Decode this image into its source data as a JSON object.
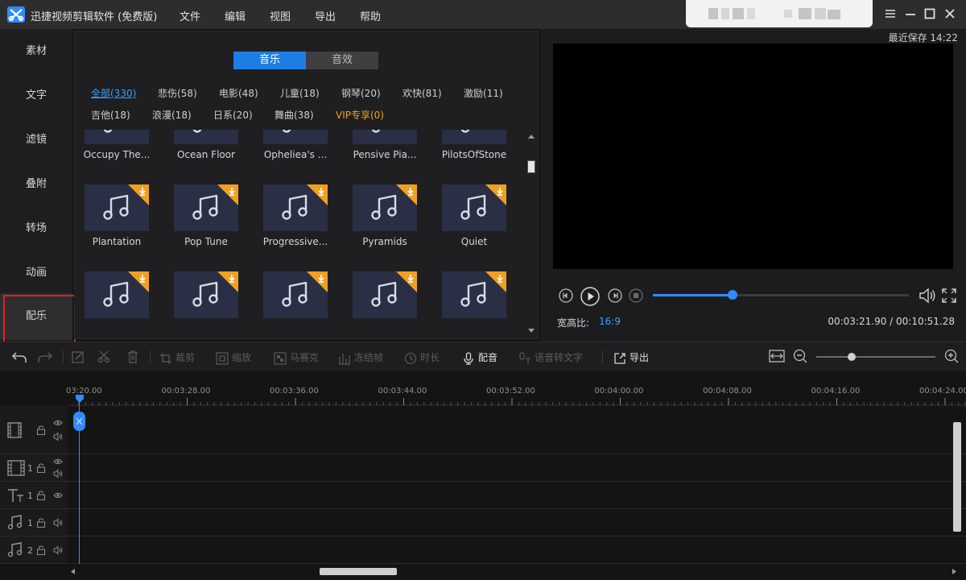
{
  "app": {
    "title": "迅捷视频剪辑软件 (免费版)",
    "menu": [
      "文件",
      "编辑",
      "视图",
      "导出",
      "帮助"
    ]
  },
  "left_tabs": [
    "素材",
    "文字",
    "滤镜",
    "叠附",
    "转场",
    "动画",
    "配乐"
  ],
  "left_tabs_active": "配乐",
  "library": {
    "segments": [
      "音乐",
      "音效"
    ],
    "active_segment": "音乐",
    "categories_row1": [
      "全部(330)",
      "悲伤(58)",
      "电影(48)",
      "儿童(18)",
      "钢琴(20)",
      "欢快(81)",
      "激励(11)"
    ],
    "categories_row2": [
      "吉他(18)",
      "浪漫(18)",
      "日系(20)",
      "舞曲(38)",
      "VIP专享(0)"
    ],
    "active_category": "全部(330)",
    "rows": [
      [
        "Occupy The...",
        "Ocean Floor",
        "Opheliea's ...",
        "Pensive Pia...",
        "PilotsOfStone"
      ],
      [
        "Plantation",
        "Pop Tune",
        "Progressive...",
        "Pyramids",
        "Quiet"
      ],
      [
        "",
        "",
        "",
        "",
        ""
      ]
    ]
  },
  "preview": {
    "last_save": "最近保存 14:22",
    "aspect_label": "宽高比:",
    "aspect_value": "16:9",
    "timecode": "00:03:21.90 / 00:10:51.28",
    "progress": 0.31
  },
  "toolbar": {
    "items": [
      "裁剪",
      "缩放",
      "马赛克",
      "冻结帧",
      "时长",
      "配音",
      "语音转文字",
      "导出"
    ],
    "zoom_level": 0.3
  },
  "timeline": {
    "ticks": [
      "03:20.00",
      "00:03:28.00",
      "00:03:36.00",
      "00:03:44.00",
      "00:03:52.00",
      "00:04:00.00",
      "00:04:08.00",
      "00:04:16.00",
      "00:04:24.00"
    ],
    "track_numbers": [
      "1",
      "1",
      "1",
      "2"
    ]
  },
  "colors": {
    "accent": "#1c7ee6",
    "vip": "#f0a020",
    "highlight": "#e02020",
    "card": "#2a2f45"
  }
}
